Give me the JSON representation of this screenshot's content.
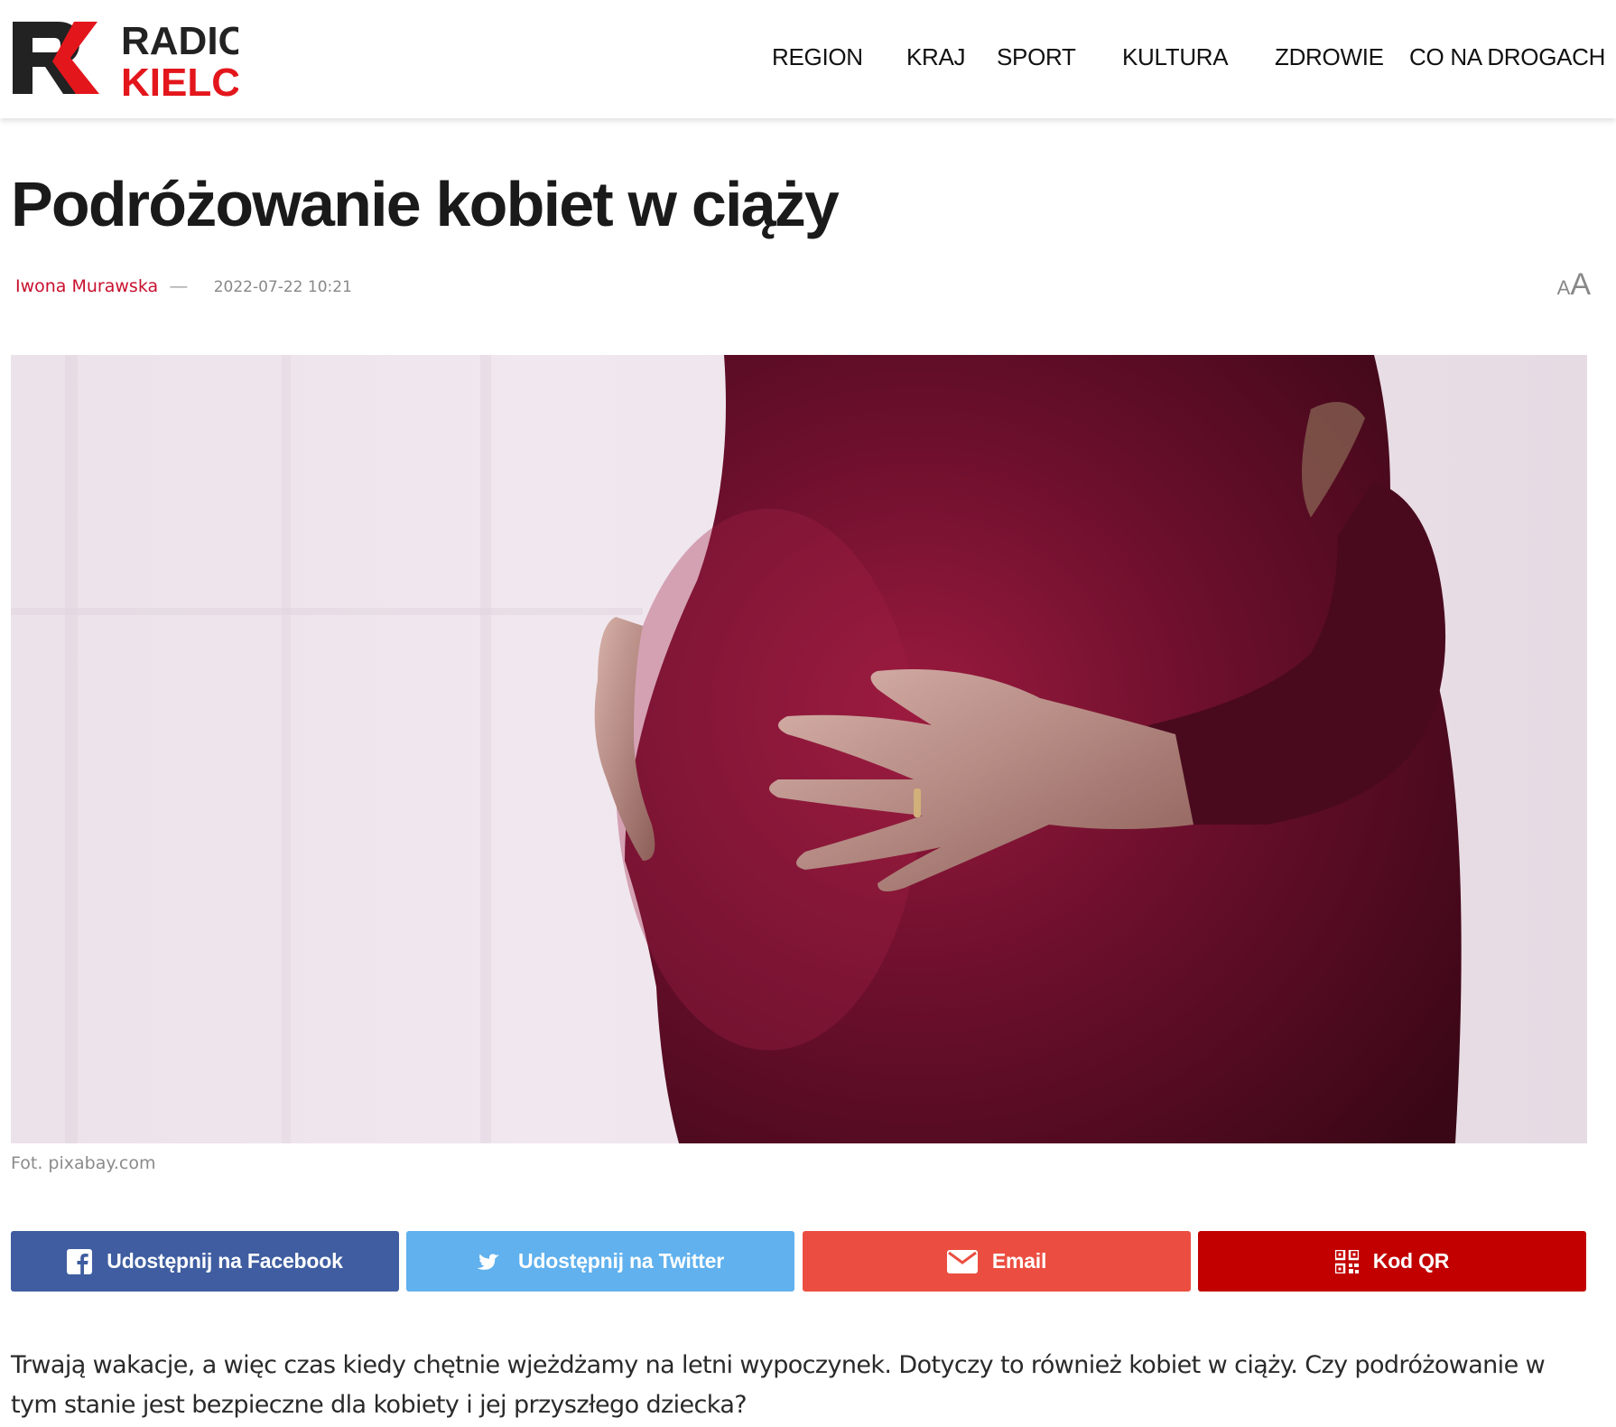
{
  "brand": {
    "logo_text_top": "RADIO",
    "logo_text_bottom": "KIELCE",
    "logo_monogram": "RK",
    "red": "#e3161c",
    "dark": "#222222"
  },
  "nav": {
    "items": [
      {
        "label": "REGION"
      },
      {
        "label": "KRAJ"
      },
      {
        "label": "SPORT"
      },
      {
        "label": "KULTURA"
      },
      {
        "label": "ZDROWIE"
      },
      {
        "label": "CO NA DROGACH"
      }
    ]
  },
  "article": {
    "title": "Podróżowanie kobiet w ciąży",
    "author": "Iwona Murawska",
    "separator": "—",
    "date": "2022-07-22 10:21",
    "font_size_control": {
      "small": "A",
      "large": "A"
    },
    "image_caption": "Fot. pixabay.com",
    "lead": "Trwają wakacje, a więc czas kiedy chętnie wjeżdżamy na letni wypoczynek. Dotyczy to również kobiet w ciąży. Czy podróżowanie w tym stanie jest bezpieczne dla kobiety i jej przyszłego dziecka?"
  },
  "share": {
    "facebook": {
      "label": "Udostępnij na Facebook",
      "icon": "facebook-icon",
      "color": "#3f5da0"
    },
    "twitter": {
      "label": "Udostępnij na Twitter",
      "icon": "twitter-icon",
      "color": "#60b1ee"
    },
    "email": {
      "label": "Email",
      "icon": "envelope-icon",
      "color": "#eb4e40"
    },
    "qr": {
      "label": "Kod QR",
      "icon": "qr-code-icon",
      "color": "#c20000"
    }
  }
}
